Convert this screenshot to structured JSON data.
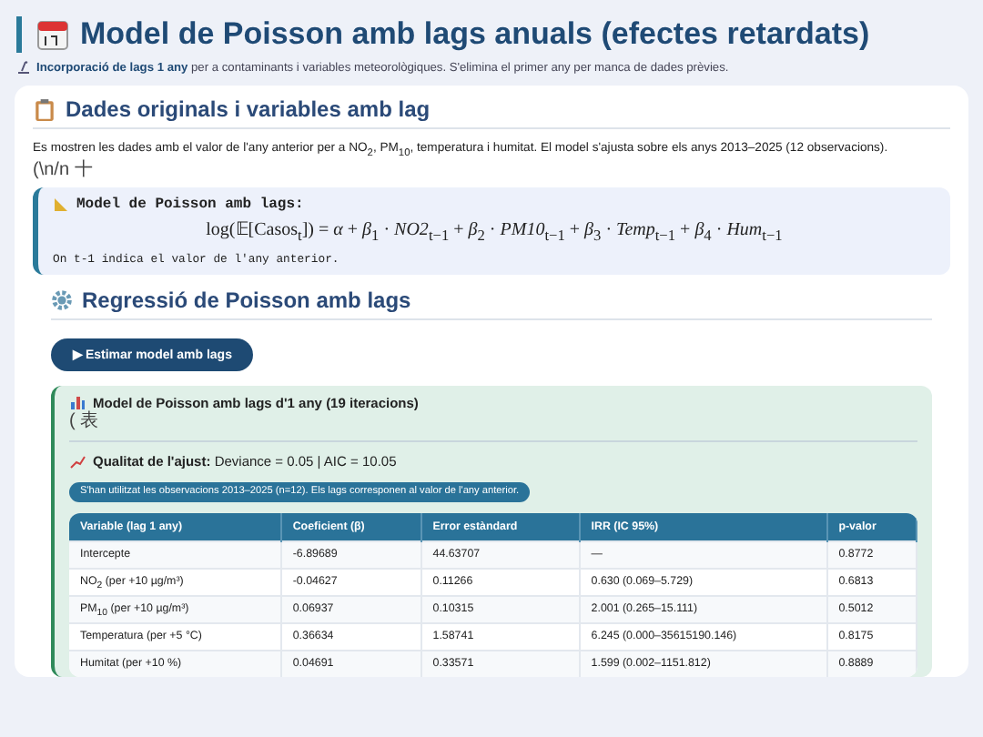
{
  "header": {
    "title": "Model de Poisson amb lags anuals (efectes retardats)",
    "subtitle": "**Incorporació de lags 1 any** per a contaminants i variables meteorològiques. S'elimina el primer any per manca de dades prèvies."
  },
  "data_card": {
    "title": "Dades originals i variables amb lag",
    "description": "Es mostren les dades amb el valor de l'any anterior per a NO$_{2}$, PM$_{10}$, temperatura i humitat. El model s'ajusta sobre els anys 2013–2025 (12 observacions).",
    "stray_text": "(\\n/n 十",
    "formula_box": {
      "title": "Model de Poisson amb lags:",
      "formula": "log(𝔼[Casos$_{t}$]) = *α* + *β*$_{1}$ · *NO2*$_{t−1}$ + *β*$_{2}$ · *PM10*$_{t−1}$ + *β*$_{3}$ · *Temp*$_{t−1}$ + *β*$_{4}$ · *Hum*$_{t−1}$",
      "note": "On t-1 indica el valor de l'any anterior."
    }
  },
  "regression": {
    "title": "Regressió de Poisson amb lags",
    "button": "▶ Estimar model amb lags",
    "result": {
      "title": "Model de Poisson amb lags d'1 any (19 iteracions)",
      "stray_text": "( 表",
      "fit_label": "Qualitat de l'ajust:",
      "fit_value": "Deviance = 0.05 | AIC = 10.05",
      "info_badge": "S'han utilitzat les observacions 2013–2025 (n=12). Els lags corresponen al valor de l'any anterior.",
      "table": {
        "columns": [
          "Variable (lag 1 any)",
          "Coeficient (β)",
          "Error estàndard",
          "IRR (IC 95%)",
          "p-valor"
        ],
        "rows": [
          [
            "Intercepte",
            "-6.89689",
            "44.63707",
            "—",
            "0.8772"
          ],
          [
            "NO$_{2}$ (per +10 µg/m³)",
            "-0.04627",
            "0.11266",
            "0.630 (0.069–5.729)",
            "0.6813"
          ],
          [
            "PM$_{10}$ (per +10 µg/m³)",
            "0.06937",
            "0.10315",
            "2.001 (0.265–15.111)",
            "0.5012"
          ],
          [
            "Temperatura (per +5 °C)",
            "0.36634",
            "1.58741",
            "6.245 (0.000–35615190.146)",
            "0.8175"
          ],
          [
            "Humitat (per +10 %)",
            "0.04691",
            "0.33571",
            "1.599 (0.002–1151.812)",
            "0.8889"
          ]
        ]
      }
    }
  }
}
